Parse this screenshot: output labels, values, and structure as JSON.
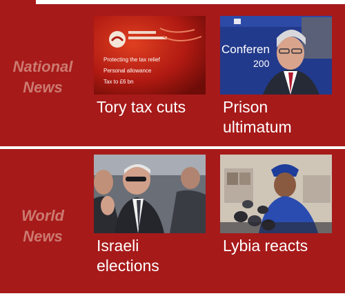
{
  "sections": [
    {
      "title_line1": "National",
      "title_line2": "News",
      "stories": [
        {
          "caption_line1": "Tory tax cuts",
          "caption_line2": "",
          "thumb_text": [
            "Protecting the tax relief",
            "Personal allowance",
            "Tax to £6 bn"
          ]
        },
        {
          "caption_line1": "Prison",
          "caption_line2": "ultimatum",
          "thumb_text": [
            "Conferen",
            "200"
          ]
        }
      ]
    },
    {
      "title_line1": "World",
      "title_line2": "News",
      "stories": [
        {
          "caption_line1": "Israeli",
          "caption_line2": "elections"
        },
        {
          "caption_line1": "Lybia reacts",
          "caption_line2": ""
        }
      ]
    }
  ],
  "colors": {
    "section_bg": "#a71a1a",
    "title": "#cc7a70",
    "caption": "#ffffff"
  }
}
